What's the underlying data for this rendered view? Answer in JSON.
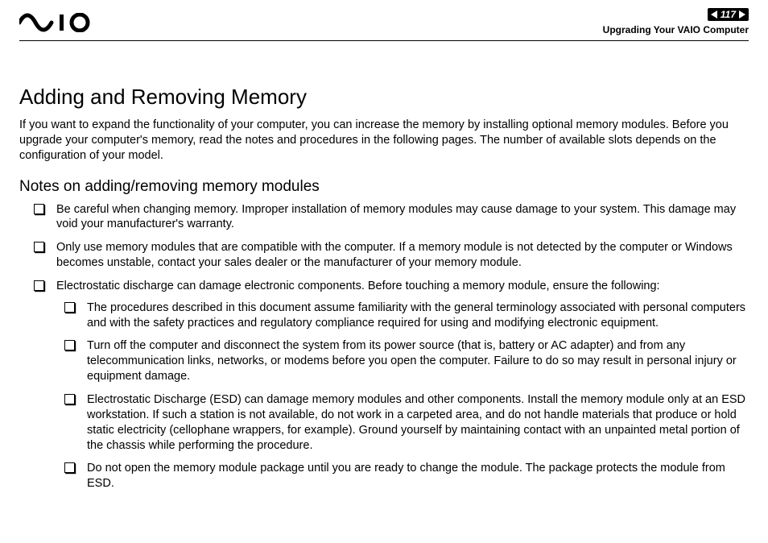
{
  "header": {
    "page_number": "117",
    "section": "Upgrading Your VAIO Computer"
  },
  "content": {
    "h1": "Adding and Removing Memory",
    "intro": "If you want to expand the functionality of your computer, you can increase the memory by installing optional memory modules. Before you upgrade your computer's memory, read the notes and procedures in the following pages. The number of available slots depends on the configuration of your model.",
    "h2": "Notes on adding/removing memory modules",
    "bullets": [
      "Be careful when changing memory. Improper installation of memory modules may cause damage to your system. This damage may void your manufacturer's warranty.",
      "Only use memory modules that are compatible with the computer. If a memory module is not detected by the computer or Windows becomes unstable, contact your sales dealer or the manufacturer of your memory module.",
      "Electrostatic discharge can damage electronic components. Before touching a memory module, ensure the following:"
    ],
    "sub_bullets": [
      "The procedures described in this document assume familiarity with the general terminology associated with personal computers and with the safety practices and regulatory compliance required for using and modifying electronic equipment.",
      "Turn off the computer and disconnect the system from its power source (that is, battery or AC adapter) and from any telecommunication links, networks, or modems before you open the computer. Failure to do so may result in personal injury or equipment damage.",
      "Electrostatic Discharge (ESD) can damage memory modules and other components. Install the memory module only at an ESD workstation. If such a station is not available, do not work in a carpeted area, and do not handle materials that produce or hold static electricity (cellophane wrappers, for example). Ground yourself by maintaining contact with an unpainted metal portion of the chassis while performing the procedure.",
      "Do not open the memory module package until you are ready to change the module. The package protects the module from ESD."
    ]
  }
}
